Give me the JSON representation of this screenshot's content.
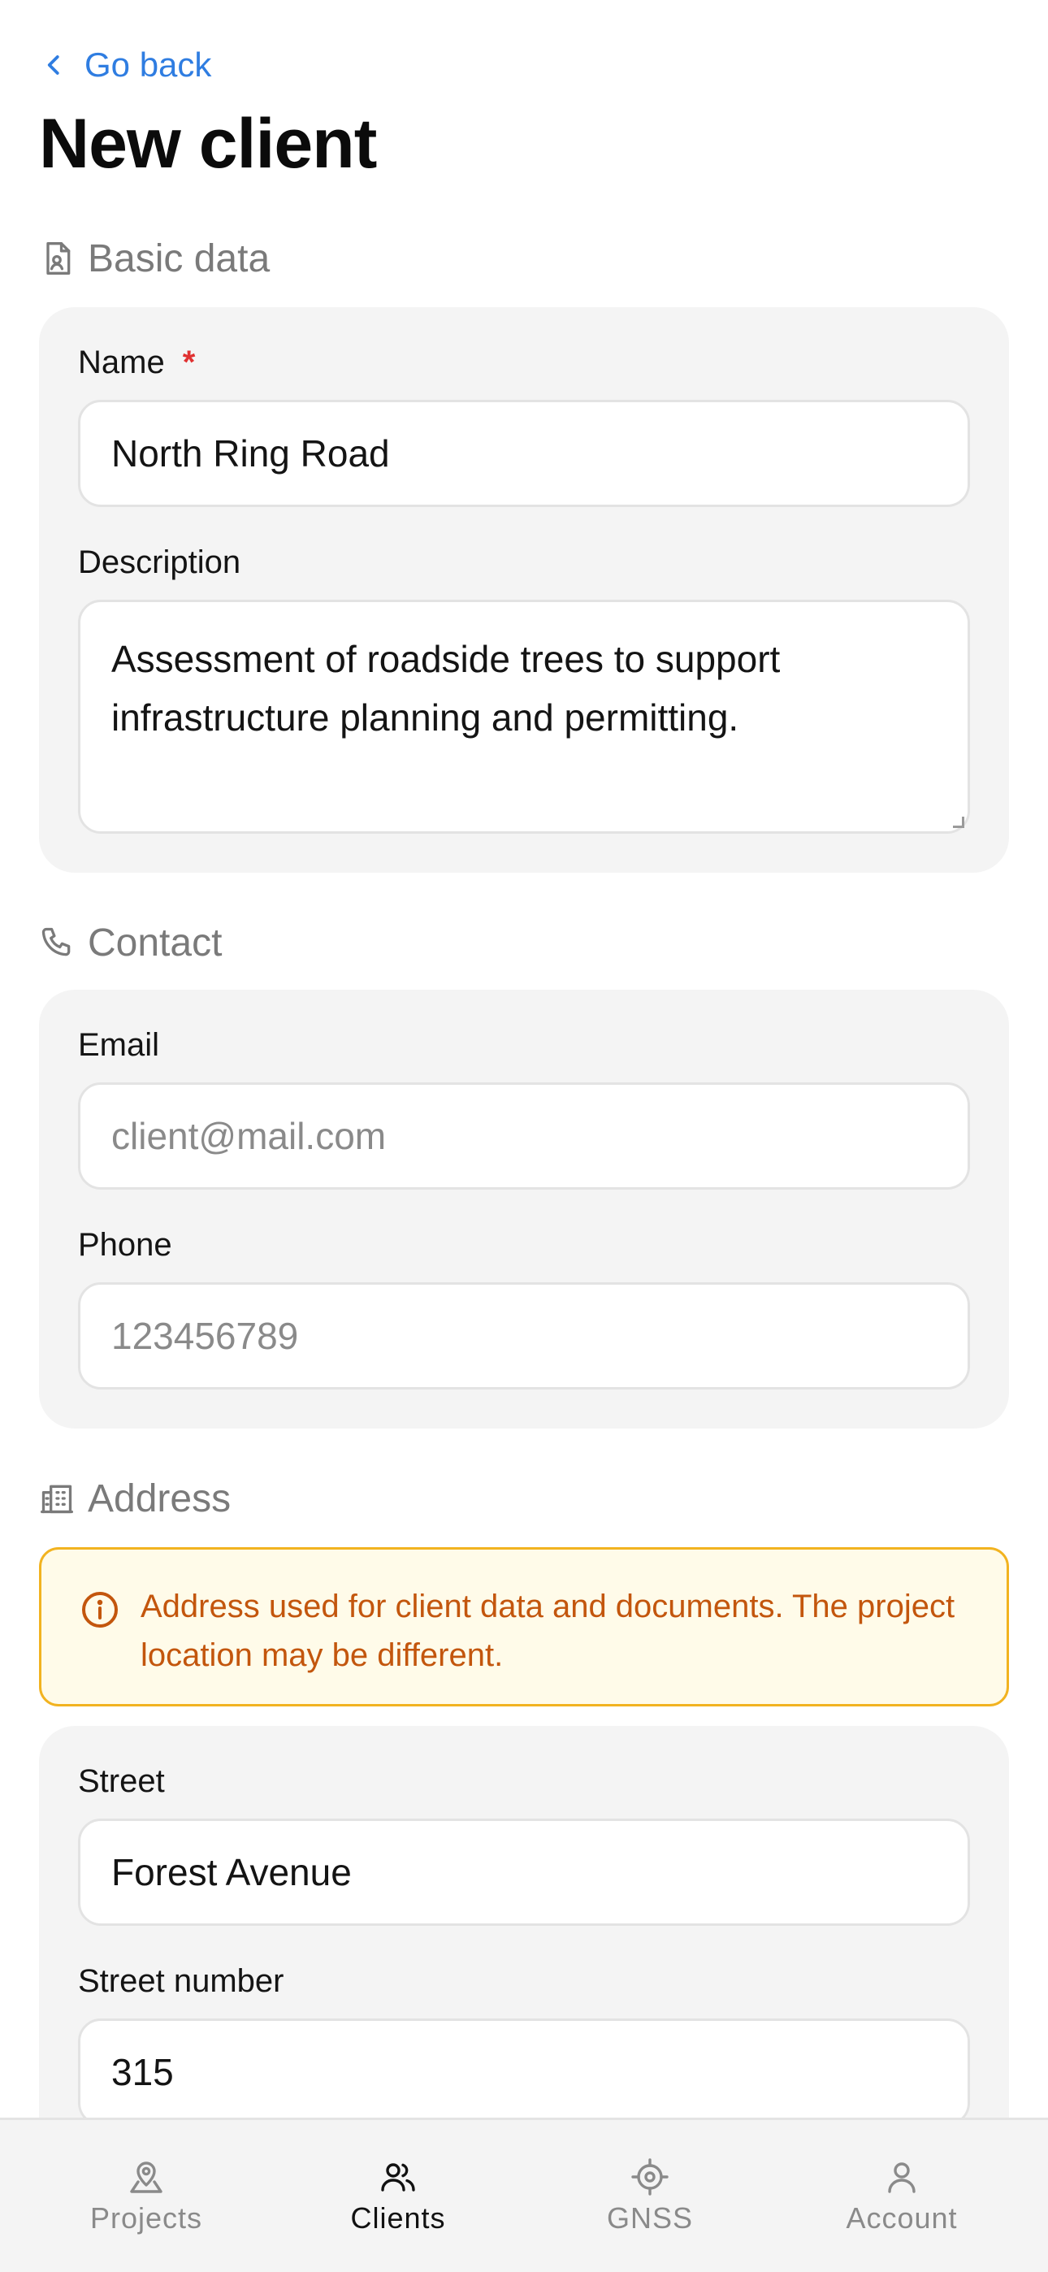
{
  "header": {
    "back_label": "Go back",
    "title": "New client"
  },
  "sections": {
    "basic": {
      "title": "Basic data"
    },
    "contact": {
      "title": "Contact"
    },
    "address": {
      "title": "Address"
    }
  },
  "basic": {
    "name_label": "Name",
    "name_required": "*",
    "name_value": "North Ring Road",
    "description_label": "Description",
    "description_value": "Assessment of roadside trees to support infrastructure planning and permitting."
  },
  "contact": {
    "email_label": "Email",
    "email_placeholder": "client@mail.com",
    "phone_label": "Phone",
    "phone_placeholder": "123456789"
  },
  "address": {
    "notice": "Address used for client data and documents. The project location may be different.",
    "street_label": "Street",
    "street_value": "Forest Avenue",
    "street_number_label": "Street number",
    "street_number_value": "315"
  },
  "nav": {
    "items": [
      {
        "label": "Projects",
        "icon": "map-pin-icon",
        "active": false
      },
      {
        "label": "Clients",
        "icon": "users-icon",
        "active": true
      },
      {
        "label": "GNSS",
        "icon": "crosshair-icon",
        "active": false
      },
      {
        "label": "Account",
        "icon": "user-icon",
        "active": false
      }
    ]
  },
  "colors": {
    "accent": "#2f7de1",
    "required": "#e03131",
    "notice_border": "#f2b320",
    "notice_bg": "#fffbe9",
    "notice_text": "#c3560d",
    "card_bg": "#f4f4f4"
  }
}
